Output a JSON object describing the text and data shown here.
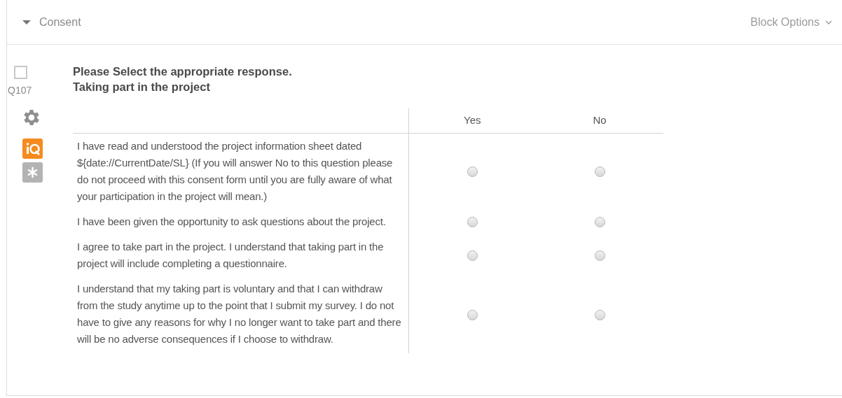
{
  "block": {
    "title": "Consent",
    "expanded": true,
    "options_label": "Block Options"
  },
  "question": {
    "number": "Q107",
    "checked": false,
    "title": "Please Select the appropriate response.\nTaking part in the project",
    "columns": [
      "Yes",
      "No"
    ],
    "rows": [
      {
        "statement": "I have read and understood the project information sheet dated ${date://CurrentDate/SL} (If you will answer No to this question please do not proceed with this consent form until you are fully aware of what your participation in the project will mean.)",
        "answers": [
          {
            "selected": false
          },
          {
            "selected": false
          }
        ]
      },
      {
        "statement": "I have been given the opportunity to ask questions about the project.",
        "answers": [
          {
            "selected": false
          },
          {
            "selected": false
          }
        ]
      },
      {
        "statement": "I agree to take part in the project. I understand that taking part in the project will include completing a questionnaire.",
        "answers": [
          {
            "selected": false
          },
          {
            "selected": false
          }
        ]
      },
      {
        "statement": "I understand that my taking part is voluntary and that I can withdraw from the study anytime up to the point that I submit my survey. I do not have to give any reasons for why I no longer want to take part and there will be no adverse consequences if I choose to withdraw.",
        "answers": [
          {
            "selected": false
          },
          {
            "selected": false
          }
        ]
      }
    ]
  }
}
